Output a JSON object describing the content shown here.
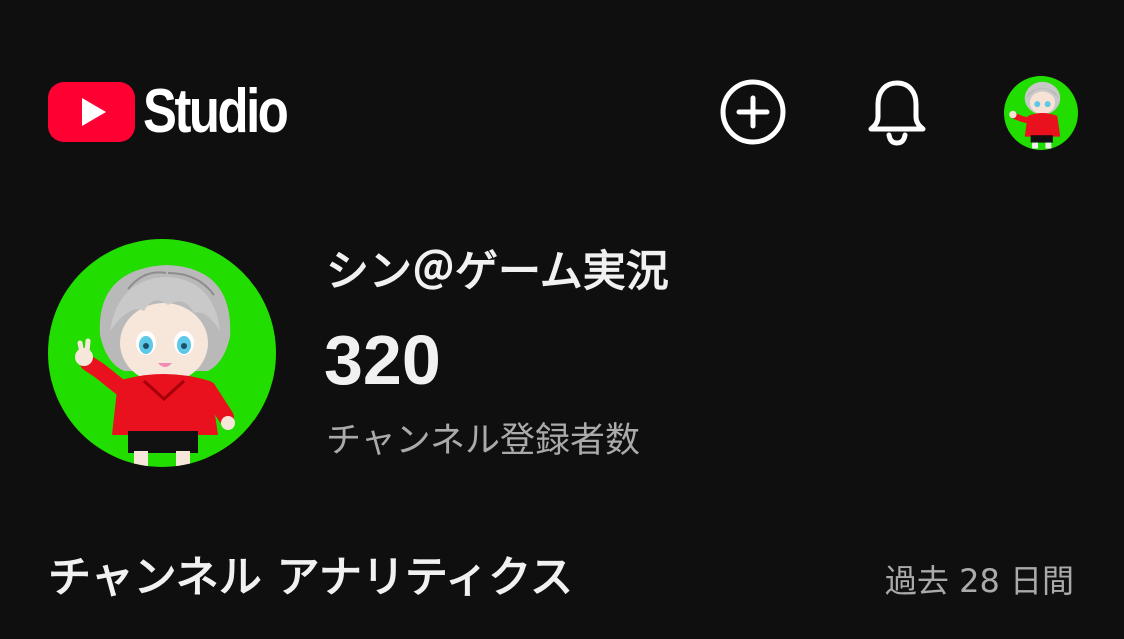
{
  "colors": {
    "background": "#0f0f0f",
    "youtube_red": "#ff0033",
    "text_primary": "#f1f1f1",
    "text_secondary": "#aaaaaa",
    "avatar_bg": "#22dd00",
    "hoodie": "#e8111d"
  },
  "header": {
    "logo_text": "Studio",
    "icons": {
      "create": "add-circle-icon",
      "notifications": "bell-icon",
      "account": "account-avatar"
    }
  },
  "channel": {
    "name": "シン＠ゲーム実況",
    "subscriber_count": "320",
    "subscriber_label": "チャンネル登録者数"
  },
  "analytics": {
    "title": "チャンネル アナリティクス",
    "period": "過去 28 日間"
  }
}
